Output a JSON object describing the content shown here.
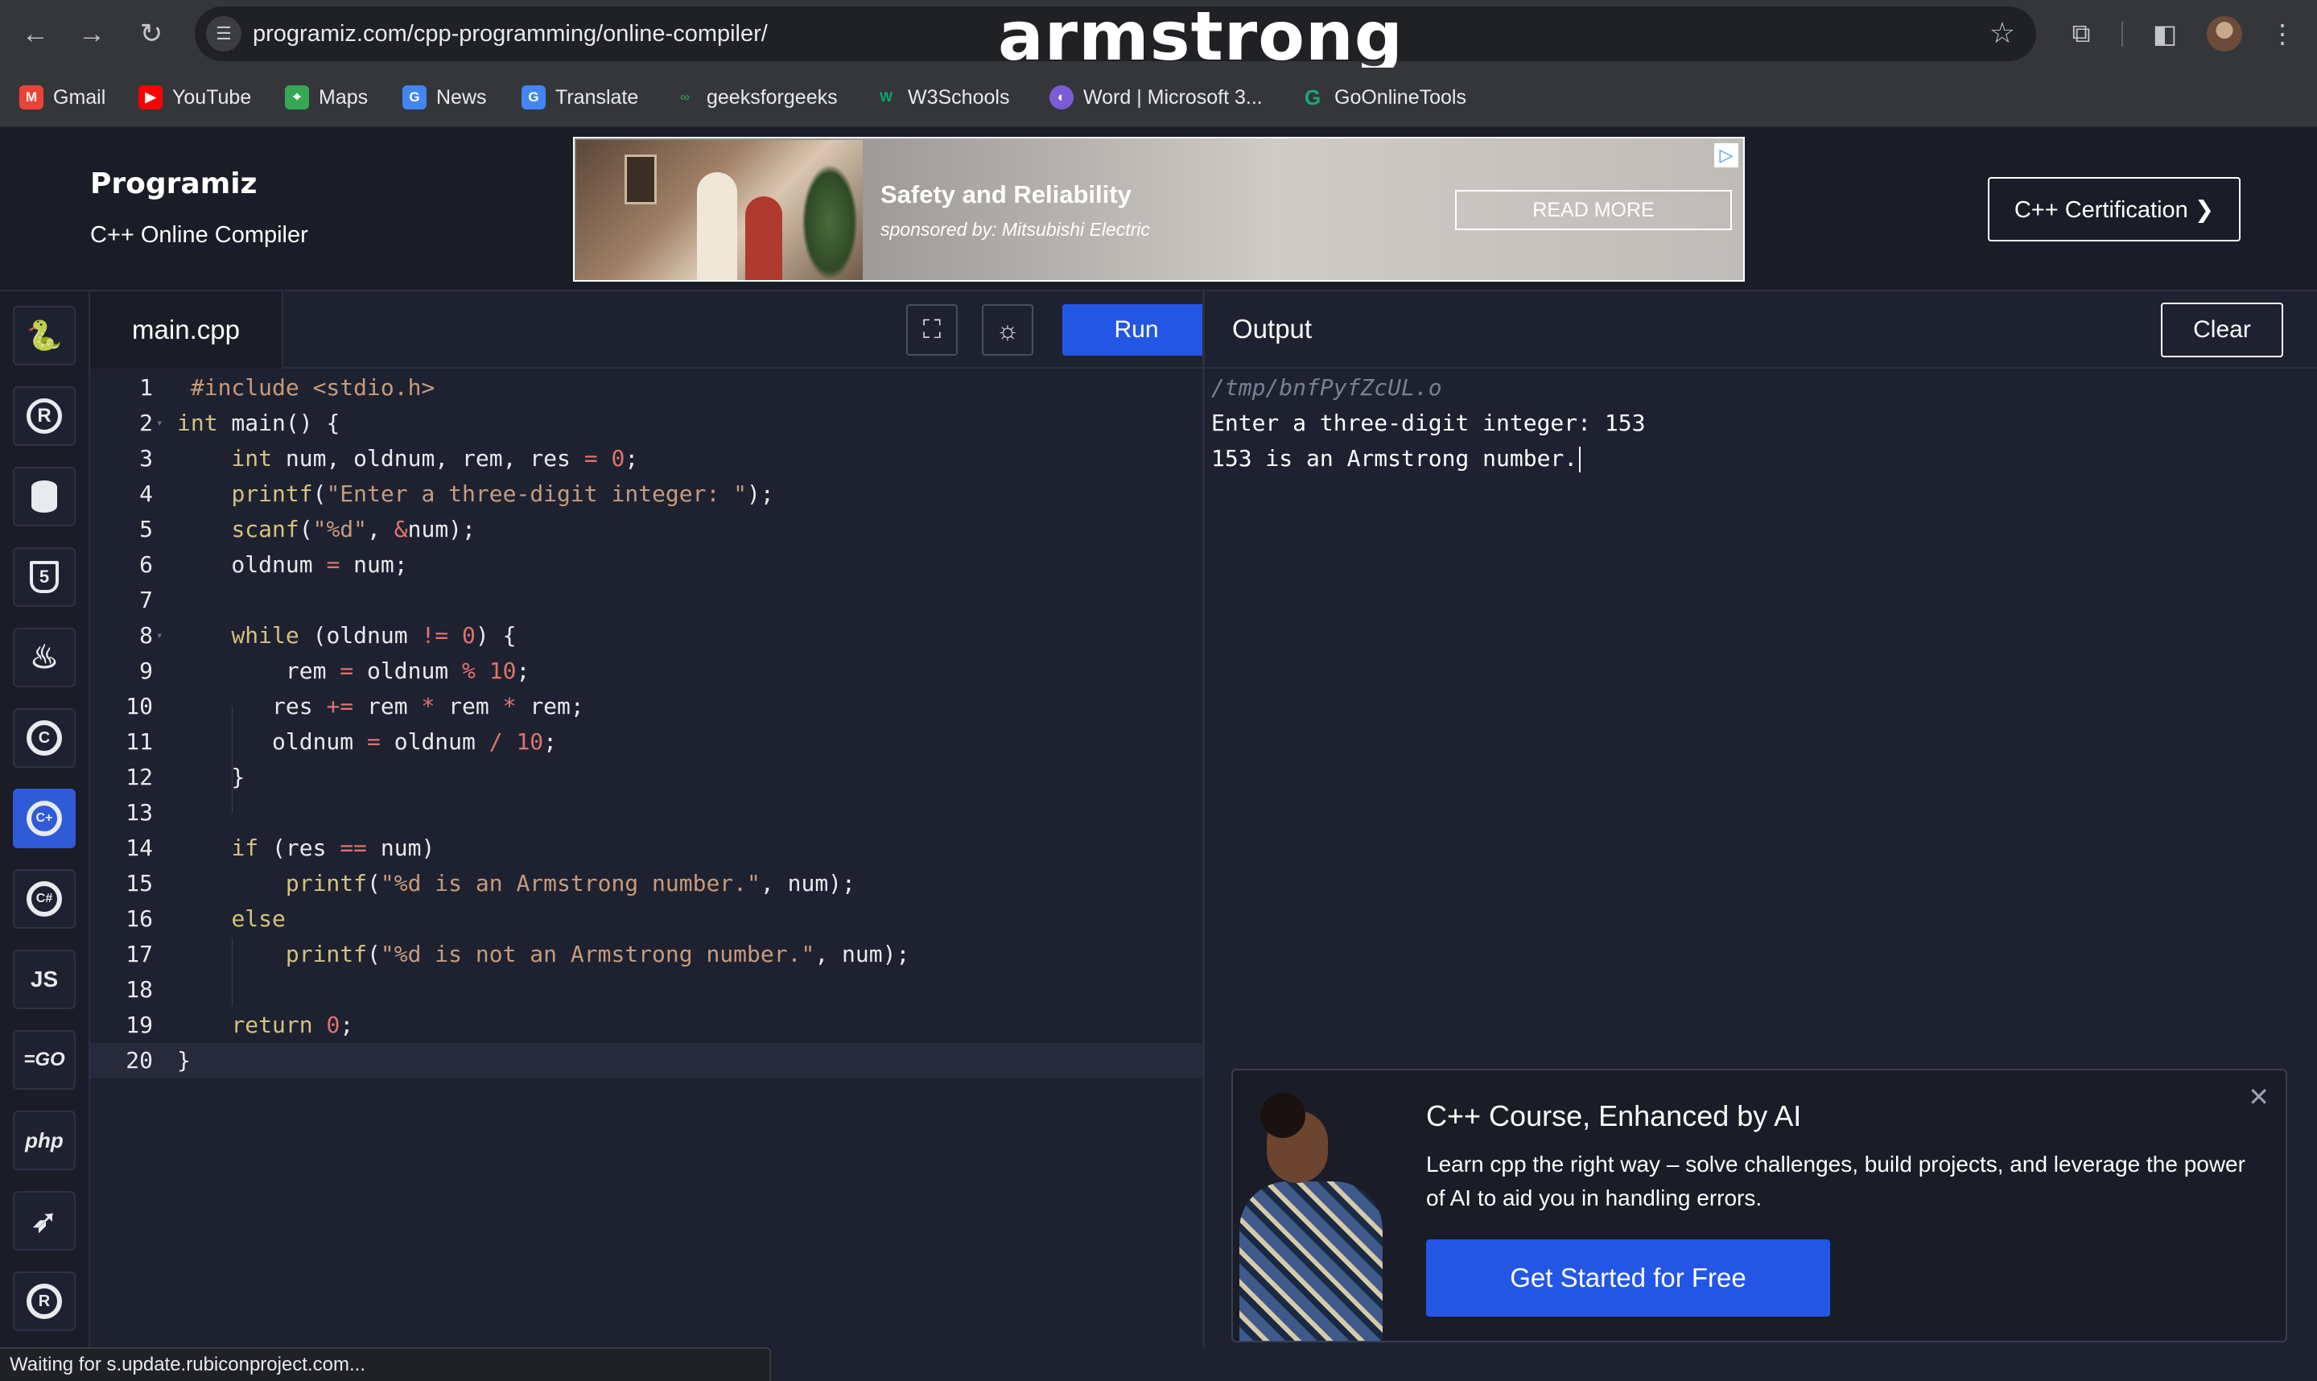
{
  "browser": {
    "url": "programiz.com/cpp-programming/online-compiler/",
    "overlay_title": "armstrong",
    "bookmarks": [
      {
        "label": "Gmail",
        "icon": "gmail-icon",
        "color": "#ea4335"
      },
      {
        "label": "YouTube",
        "icon": "youtube-icon",
        "color": "#ff0000"
      },
      {
        "label": "Maps",
        "icon": "maps-icon",
        "color": "#34a853"
      },
      {
        "label": "News",
        "icon": "news-icon",
        "color": "#4285f4"
      },
      {
        "label": "Translate",
        "icon": "translate-icon",
        "color": "#4285f4"
      },
      {
        "label": "geeksforgeeks",
        "icon": "geeksforgeeks-icon",
        "color": "#2f8d46"
      },
      {
        "label": "W3Schools",
        "icon": "w3schools-icon",
        "color": "#04aa6d"
      },
      {
        "label": "Word | Microsoft 3...",
        "icon": "word-icon",
        "color": "#7b5cd6"
      },
      {
        "label": "GoOnlineTools",
        "icon": "goonlinetools-icon",
        "color": "#19a974"
      }
    ]
  },
  "header": {
    "logo": "Programiz",
    "subtitle": "C++ Online Compiler",
    "ad": {
      "title": "Safety and Reliability",
      "sponsor": "sponsored by: Mitsubishi Electric",
      "cta": "READ MORE"
    },
    "certification_button": "C++ Certification ❯"
  },
  "sidebar": {
    "languages": [
      {
        "name": "python",
        "glyph": "🐍"
      },
      {
        "name": "r",
        "glyph": "R"
      },
      {
        "name": "sql",
        "glyph": "🛢"
      },
      {
        "name": "html",
        "glyph": "5"
      },
      {
        "name": "java",
        "glyph": "♨"
      },
      {
        "name": "c",
        "glyph": "C"
      },
      {
        "name": "cpp",
        "glyph": "C+"
      },
      {
        "name": "csharp",
        "glyph": "C#"
      },
      {
        "name": "javascript",
        "glyph": "JS"
      },
      {
        "name": "go",
        "glyph": "=GO"
      },
      {
        "name": "php",
        "glyph": "php"
      },
      {
        "name": "swift",
        "glyph": "➶"
      },
      {
        "name": "rust",
        "glyph": "®"
      }
    ],
    "active": "cpp"
  },
  "editor": {
    "filename": "main.cpp",
    "run_label": "Run",
    "code": [
      "#include <stdio.h>",
      "int main() {",
      "    int num, oldnum, rem, res = 0;",
      "    printf(\"Enter a three-digit integer: \");",
      "    scanf(\"%d\", &num);",
      "    oldnum = num;",
      "",
      "    while (oldnum != 0) {",
      "        rem = oldnum % 10;",
      "       res += rem * rem * rem;",
      "       oldnum = oldnum / 10;",
      "    }",
      "",
      "    if (res == num)",
      "        printf(\"%d is an Armstrong number.\", num);",
      "    else",
      "        printf(\"%d is not an Armstrong number.\", num);",
      "",
      "    return 0;",
      "}"
    ]
  },
  "output": {
    "title": "Output",
    "clear_label": "Clear",
    "lines": [
      "/tmp/bnfPyfZcUL.o",
      "Enter a three-digit integer: 153",
      "153 is an Armstrong number."
    ]
  },
  "promo": {
    "title": "C++ Course, Enhanced by AI",
    "text": "Learn cpp the right way – solve challenges, build projects, and leverage the power of AI to aid you in handling errors.",
    "cta": "Get Started for Free"
  },
  "status_bar": "Waiting for s.update.rubiconproject.com..."
}
